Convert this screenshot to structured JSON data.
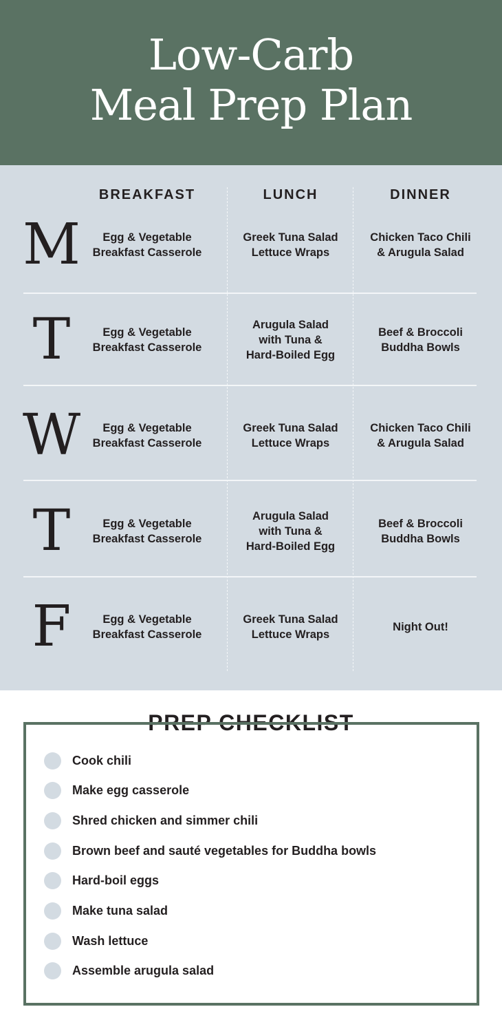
{
  "header": {
    "title_line1": "Low-Carb",
    "title_line2": "Meal Prep Plan"
  },
  "columns": [
    "BREAKFAST",
    "LUNCH",
    "DINNER"
  ],
  "days": [
    {
      "letter": "M",
      "breakfast": "Egg & Vegetable\nBreakfast Casserole",
      "lunch": "Greek Tuna Salad\nLettuce Wraps",
      "dinner": "Chicken Taco Chili\n& Arugula Salad"
    },
    {
      "letter": "T",
      "breakfast": "Egg & Vegetable\nBreakfast Casserole",
      "lunch": "Arugula Salad\nwith Tuna &\nHard-Boiled Egg",
      "dinner": "Beef & Broccoli\nBuddha Bowls"
    },
    {
      "letter": "W",
      "breakfast": "Egg & Vegetable\nBreakfast Casserole",
      "lunch": "Greek Tuna Salad\nLettuce Wraps",
      "dinner": "Chicken Taco Chili\n& Arugula Salad"
    },
    {
      "letter": "T",
      "breakfast": "Egg & Vegetable\nBreakfast Casserole",
      "lunch": "Arugula Salad\nwith Tuna &\nHard-Boiled Egg",
      "dinner": "Beef & Broccoli\nBuddha Bowls"
    },
    {
      "letter": "F",
      "breakfast": "Egg & Vegetable\nBreakfast Casserole",
      "lunch": "Greek Tuna Salad\nLettuce Wraps",
      "dinner": "Night Out!"
    }
  ],
  "checklist": {
    "title": "PREP CHECKLIST",
    "items": [
      "Cook chili",
      "Make egg casserole",
      "Shred chicken and simmer chili",
      "Brown beef and sauté vegetables for Buddha bowls",
      "Hard-boil eggs",
      "Make tuna salad",
      "Wash lettuce",
      "Assemble arugula salad"
    ]
  },
  "colors": {
    "header_bg": "#5a7263",
    "grid_bg": "#d3dbe2",
    "checkbox": "#d3dbe2",
    "text": "#231f20"
  }
}
